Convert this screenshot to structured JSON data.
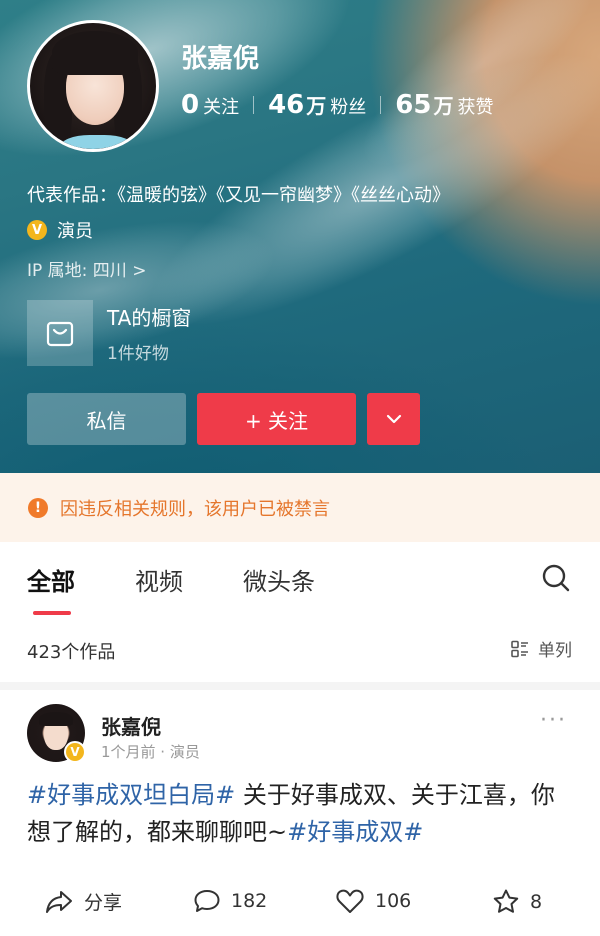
{
  "profile": {
    "name": "张嘉倪",
    "stats": [
      {
        "num": "0",
        "unit": "",
        "label": "关注"
      },
      {
        "num": "46",
        "unit": "万",
        "label": "粉丝"
      },
      {
        "num": "65",
        "unit": "万",
        "label": "获赞"
      }
    ],
    "works_line": "代表作品：《温暖的弦》《又见一帘幽梦》《丝丝心动》",
    "verify_badge": "V",
    "role": "演员",
    "ip_location": "IP 属地: 四川 >",
    "shop": {
      "title": "TA的橱窗",
      "subtitle": "1件好物"
    },
    "buttons": {
      "message": "私信",
      "follow": "+ 关注"
    }
  },
  "banner": {
    "icon": "!",
    "text": "因违反相关规则，该用户已被禁言"
  },
  "tabs": [
    {
      "label": "全部",
      "active": true
    },
    {
      "label": "视频",
      "active": false
    },
    {
      "label": "微头条",
      "active": false
    }
  ],
  "list": {
    "count": "423个作品",
    "layout_label": "单列"
  },
  "post": {
    "author": "张嘉倪",
    "verify_badge": "V",
    "meta": "1个月前 · 演员",
    "more": "···",
    "hashtag1": "#好事成双坦白局#",
    "text": " 关于好事成双、关于江喜，你想了解的，都来聊聊吧~",
    "hashtag2": "#好事成双#",
    "actions": {
      "share": "分享",
      "comments": "182",
      "likes": "106",
      "favorites": "8"
    }
  },
  "colors": {
    "accent": "#ef3b49",
    "warning": "#e5762c",
    "hashtag": "#2f64a7",
    "badge": "#f3b61d"
  }
}
